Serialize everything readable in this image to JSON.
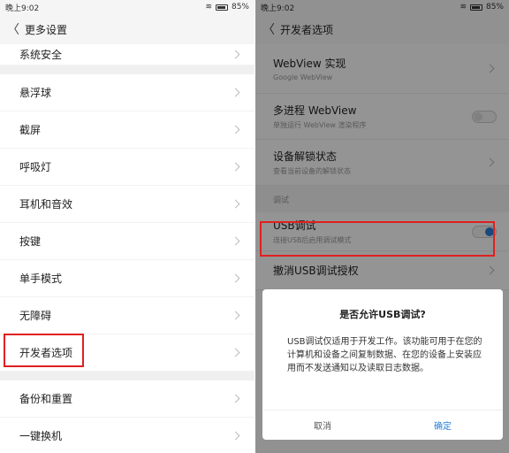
{
  "left": {
    "status": {
      "time": "晚上9:02",
      "battery": "85%"
    },
    "title": "更多设置",
    "top_item": "系统安全",
    "items": [
      "悬浮球",
      "截屏",
      "呼吸灯",
      "耳机和音效",
      "按键",
      "单手模式",
      "无障碍",
      "开发者选项"
    ],
    "bottom_items": [
      "备份和重置",
      "一键换机"
    ]
  },
  "right": {
    "status": {
      "time": "晚上9:02",
      "battery": "85%"
    },
    "title": "开发者选项",
    "rows": [
      {
        "title": "WebView 实现",
        "sub": "Google WebView"
      },
      {
        "title": "多进程 WebView",
        "sub": "单独运行 WebView 渲染程序"
      },
      {
        "title": "设备解锁状态",
        "sub": "查看当前设备的解锁状态"
      }
    ],
    "section": "调试",
    "usb": {
      "title": "USB调试",
      "sub": "连接USB后启用调试模式"
    },
    "revoke": "撤消USB调试授权",
    "dialog": {
      "title": "是否允许USB调试?",
      "message": "USB调试仅适用于开发工作。该功能可用于在您的计算机和设备之间复制数据、在您的设备上安装应用而不发送通知以及读取日志数据。",
      "cancel": "取消",
      "confirm": "确定"
    }
  },
  "colors": {
    "highlight": "#e02020",
    "accent": "#2b7fd6"
  },
  "icons": [
    "back-arrow-icon",
    "chevron-right-icon",
    "wifi-icon",
    "battery-icon"
  ]
}
